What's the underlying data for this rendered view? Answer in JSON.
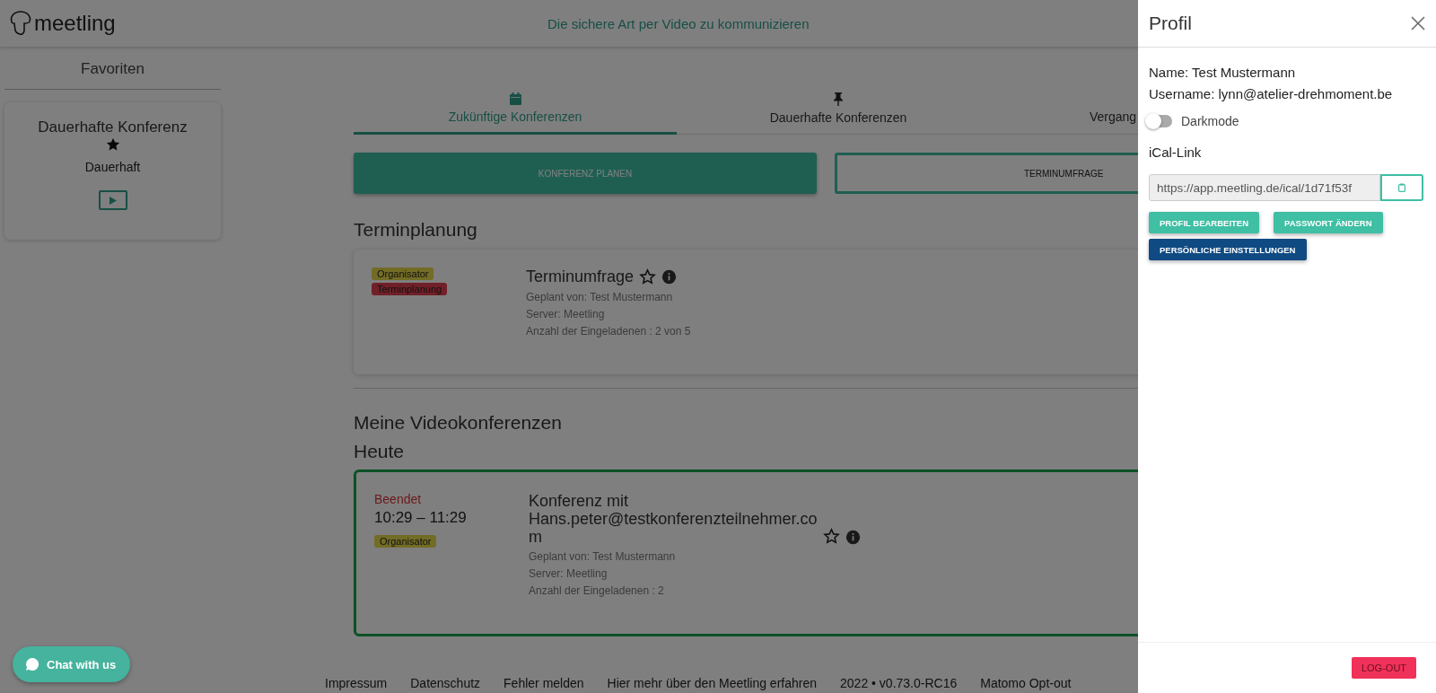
{
  "header": {
    "logo": "meetling",
    "tagline": "Die sichere Art per Video zu kommunizieren"
  },
  "sidebar": {
    "title": "Favoriten",
    "favorites": [
      {
        "title": "Dauerhafte Konferenz",
        "starred": true,
        "type": "Dauerhaft"
      }
    ]
  },
  "tabs": [
    {
      "label": "Zukünftige Konferenzen",
      "selected": true,
      "kind": "calendar"
    },
    {
      "label": "Dauerhafte Konferenzen",
      "selected": false,
      "kind": "pin"
    },
    {
      "label": "Vergang",
      "selected": false,
      "kind": "none"
    }
  ],
  "actions": [
    {
      "label": "KONFERENZ PLANEN",
      "kind": "primary"
    },
    {
      "label": "TERMINUMFRAGE",
      "kind": "outline"
    }
  ],
  "scheduling": {
    "heading": "Terminplanung",
    "cards": [
      {
        "tags": [
          {
            "label": "Organisator",
            "color": "#736c25"
          },
          {
            "label": "Terminplanung",
            "color": "#702028"
          }
        ],
        "title": "Terminumfrage",
        "starred": false,
        "lines": [
          "Geplant von: Test Mustermann",
          "Server: Meetling",
          "Anzahl der Eingeladenen : 2 von 5"
        ]
      }
    ]
  },
  "conferences": {
    "heading": "Meine Videokonferenzen",
    "day": "Heute",
    "cards": [
      {
        "status": "Beendet",
        "time": "10:29 – 11:29",
        "tags": [
          {
            "label": "Organisator",
            "color": "#736c25"
          }
        ],
        "title": "Konferenz mit Hans.peter@testkonferenzteilnehmer.com",
        "starred": false,
        "lines": [
          "Geplant von: Test Mustermann",
          "Server: Meetling",
          "Anzahl der Eingeladenen : 2"
        ]
      }
    ]
  },
  "footer": [
    "Impressum",
    "Datenschutz",
    "Fehler melden",
    "Hier mehr über den Meetling erfahren",
    "2022 • v0.73.0-RC16",
    "Matomo Opt-out"
  ],
  "chat": {
    "label": "Chat with us"
  },
  "drawer": {
    "title": "Profil",
    "name": "Name: Test Mustermann",
    "username": "Username: lynn@atelier-drehmoment.be",
    "darkmode": {
      "label": "Darkmode",
      "on": false
    },
    "ical_label": "iCal-Link",
    "ical_value": "https://app.meetling.de/ical/1d71f53f",
    "buttons": [
      {
        "label": "PROFIL BEARBEITEN",
        "kind": "teal"
      },
      {
        "label": "PASSWORT ÄNDERN",
        "kind": "teal"
      },
      {
        "label": "PERSÖNLICHE EINSTELLUNGEN",
        "kind": "navy"
      }
    ],
    "logout": "LOG-OUT"
  }
}
